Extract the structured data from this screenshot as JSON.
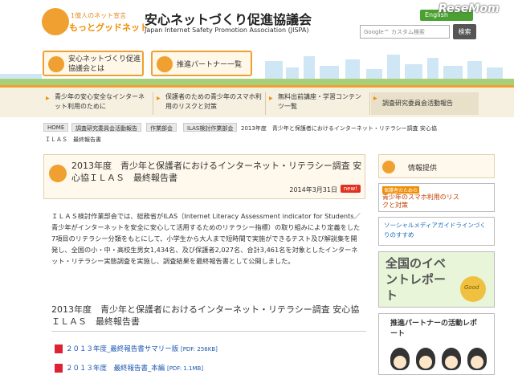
{
  "header": {
    "logo_line1": "1億人のネット宣言",
    "logo_line2": "もっとグッドネット",
    "title": "安心ネットづくり促進協議会",
    "subtitle": "Japan Internet Safety Promotion Association (JISPA)",
    "english_label": "English",
    "search_placeholder": "Google™ カスタム検索",
    "search_button": "検索",
    "watermark": "ReseMom"
  },
  "quick_links": {
    "about": "安心ネットづくり促進協議会とは",
    "partners": "推進パートナー一覧"
  },
  "nav": {
    "items": [
      "青少年の安心安全なインターネット利用のために",
      "保護者のための青少年のスマホ利用のリスクと対策",
      "無料出前講座・学習コンテンツ一覧",
      "調査研究委員会活動報告"
    ]
  },
  "breadcrumb": {
    "items": [
      "HOME",
      "調査研究委員会活動報告",
      "作業部会",
      "ILAS検討作業部会"
    ],
    "current_line1": "2013年度　青少年と保護者におけるインターネット・リテラシー調査 安心協",
    "current_line2": "ＩＬＡＳ　最終報告書"
  },
  "article": {
    "title": "2013年度　青少年と保護者におけるインターネット・リテラシー調査 安心協ＩＬＡＳ　最終報告書",
    "date": "2014年3月31日",
    "badge": "new!",
    "body": "ＩＬＡＳ検討作業部会では、総務省がILAS（Internet Literacy Assessment indicator for Students／青少年がインターネットを安全に安心して活用するためのリテラシー指標）の取り組みにより定義をした7項目のリテラシー分類をもとにして、小学生から大人まで短時間で実施ができるテスト及び解説集を開発し、全国の小・中・高校生男女1,434名、及び保護者2,027名、合計3,461名を対象としたインターネット・リテラシー実態調査を実施し、調査結果を最終報告書として公開しました。",
    "section_title": "2013年度　青少年と保護者におけるインターネット・リテラシー調査 安心協ＩＬＡＳ　最終報告書",
    "pdfs": [
      {
        "label": "２０１３年度_最終報告書サマリー版",
        "size": "[PDF: 256KB]"
      },
      {
        "label": "２０１３年度　最終報告書_本編",
        "size": "[PDF: 1.1MB]"
      }
    ]
  },
  "sidebar": {
    "heading": "情報提供",
    "banner1_tag": "保護者のための",
    "banner1_text": "青少年のスマホ利用のリスクと対策",
    "banner2_text": "ソーシャルメディアガイドラインづくりのすすめ",
    "banner3_text": "全国のイベントレポート",
    "banner3_badge": "Good",
    "banner4_text": "推進パートナーの活動レポート"
  },
  "colors": {
    "accent": "#f0a030",
    "english": "#4aa030",
    "new_badge": "#e03020",
    "link": "#1a55b0"
  }
}
